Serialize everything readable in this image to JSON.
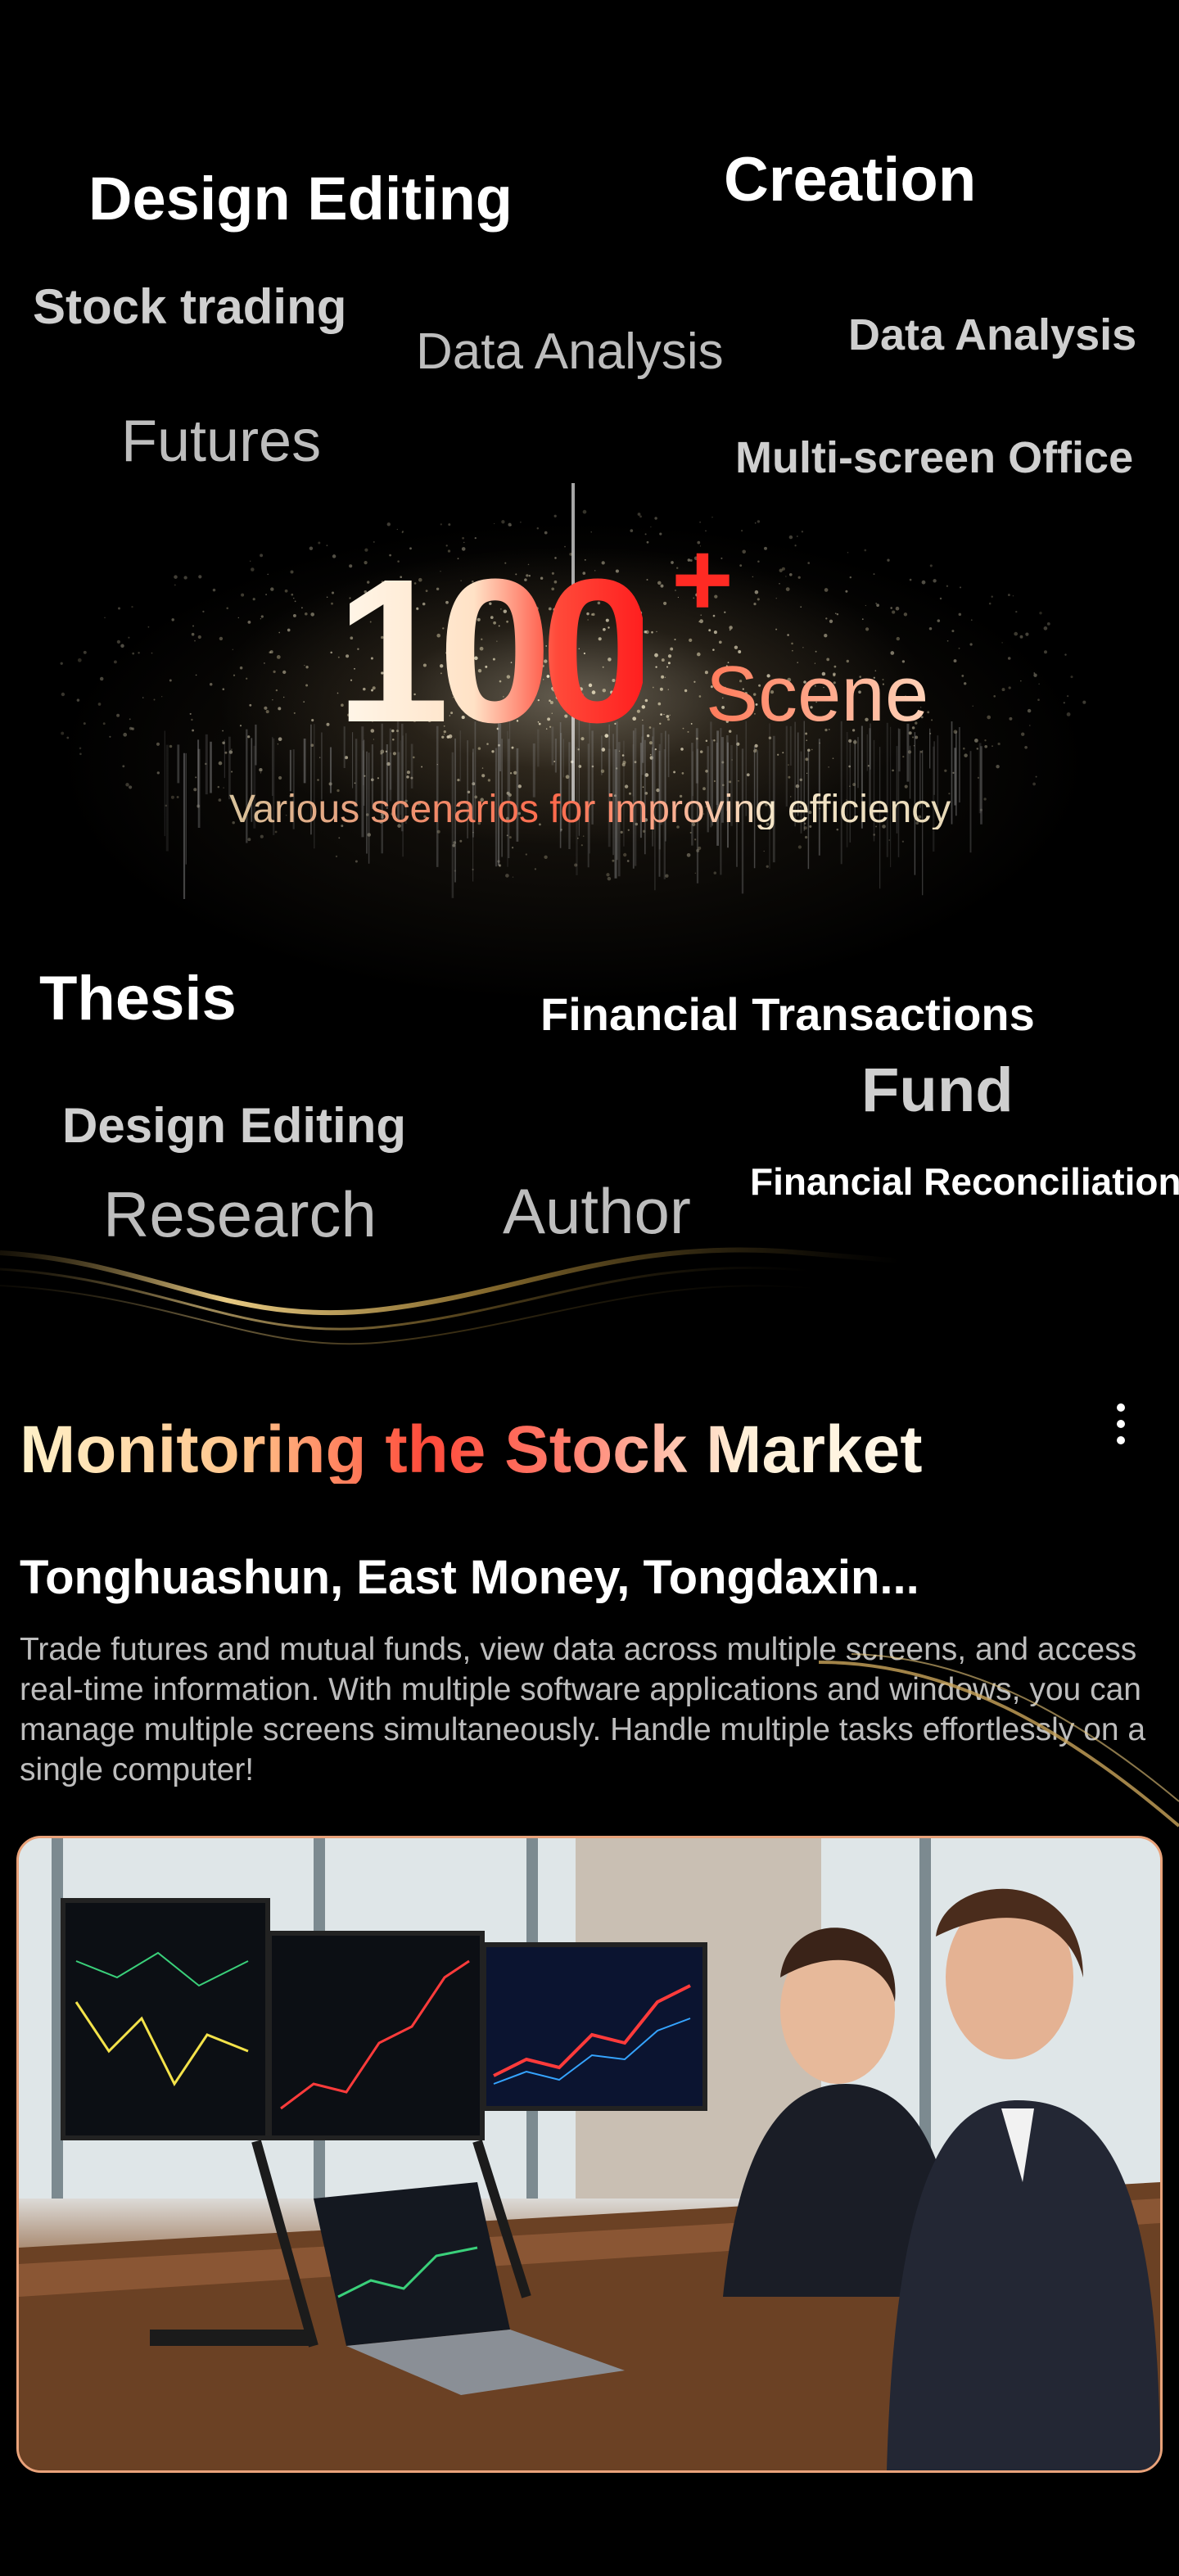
{
  "keywords": {
    "design_editing_top": "Design Editing",
    "creation": "Creation",
    "stock_trading": "Stock trading",
    "data_analysis_mid": "Data Analysis",
    "data_analysis_right": "Data Analysis",
    "futures": "Futures",
    "multi_screen_office": "Multi-screen Office",
    "thesis": "Thesis",
    "financial_transactions": "Financial Transactions",
    "fund": "Fund",
    "design_editing_bottom": "Design Editing",
    "financial_reconciliation": "Financial Reconciliation",
    "research": "Research",
    "author": "Author"
  },
  "headline": {
    "number": "100",
    "plus": "+",
    "scene": "Scene",
    "subtitle": "Various scenarios for improving efficiency"
  },
  "section": {
    "title": "Monitoring the Stock Market",
    "apps": "Tonghuashun, East Money, Tongdaxin...",
    "description": "Trade futures and mutual funds, view data across multiple screens, and access real-time information. With multiple software applications and windows, you can manage multiple screens simultaneously. Handle multiple tasks effortlessly on a single computer!"
  },
  "icons": {
    "menu": "more-vertical-icon"
  },
  "colors": {
    "accent_red": "#ff2a23",
    "photo_border": "#e9a27a",
    "background": "#000000"
  }
}
